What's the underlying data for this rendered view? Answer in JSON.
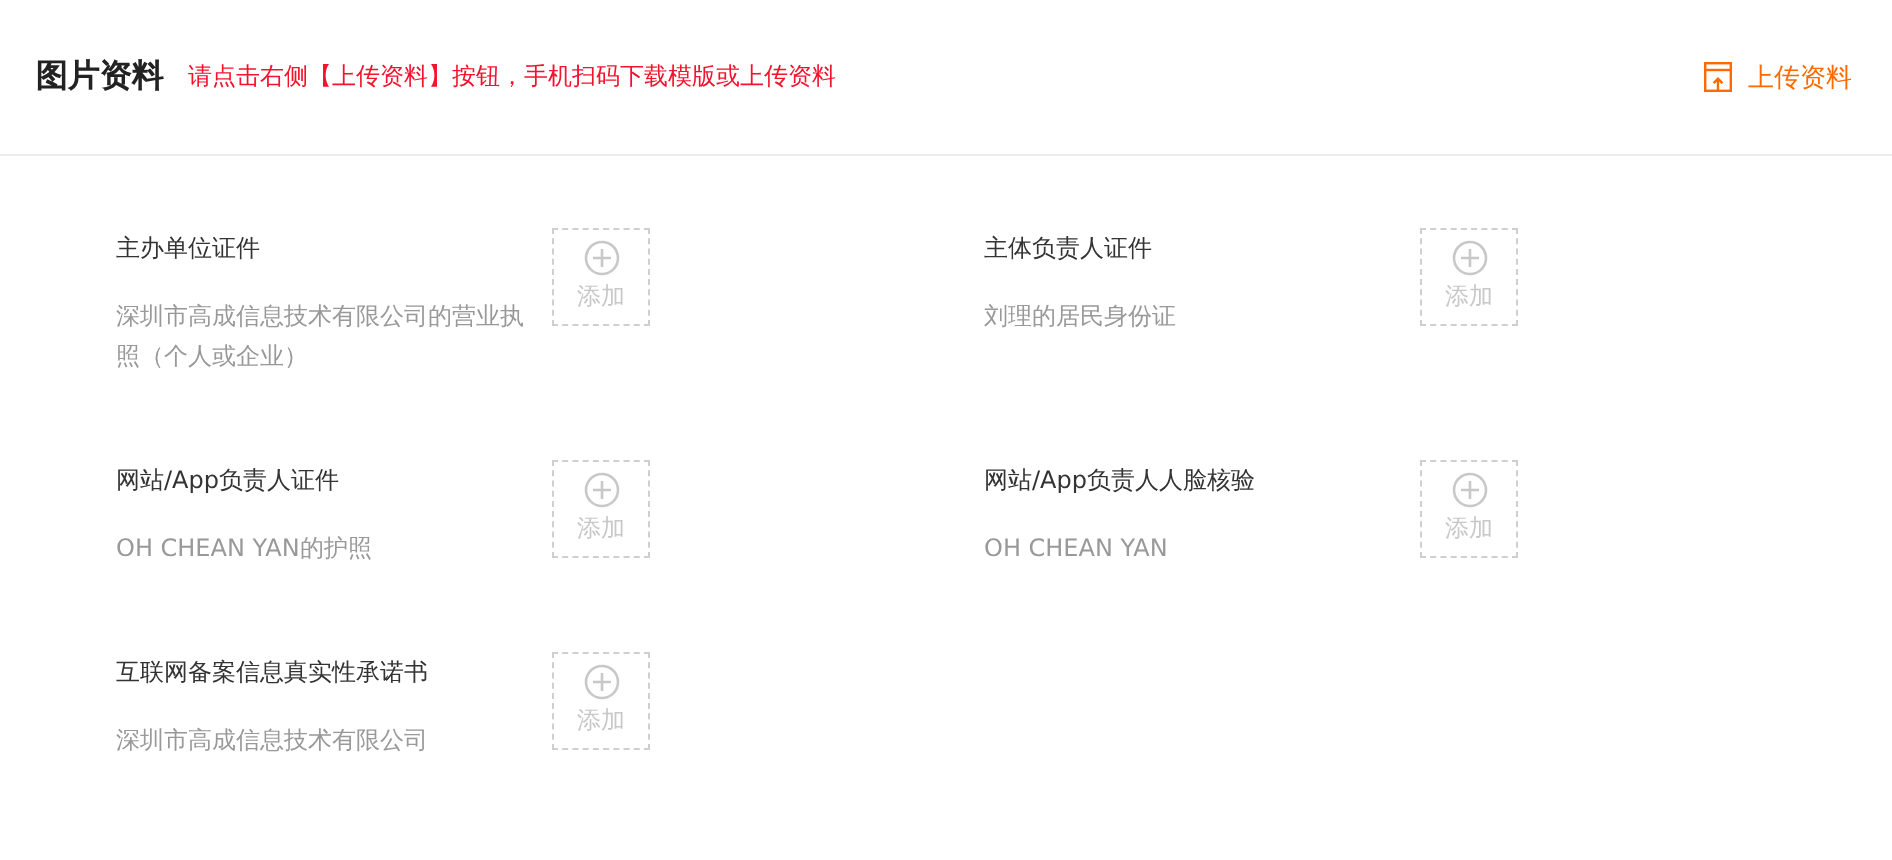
{
  "header": {
    "title": "图片资料",
    "hint": "请点击右侧【上传资料】按钮，手机扫码下载模版或上传资料",
    "upload_button": "上传资料"
  },
  "items": [
    {
      "label": "主办单位证件",
      "detail": "深圳市高成信息技术有限公司的营业执照（个人或企业）",
      "add": "添加"
    },
    {
      "label": "主体负责人证件",
      "detail": "刘理的居民身份证",
      "add": "添加"
    },
    {
      "label": "网站/App负责人证件",
      "detail": "OH CHEAN YAN的护照",
      "add": "添加"
    },
    {
      "label": "网站/App负责人人脸核验",
      "detail": "OH CHEAN YAN",
      "add": "添加"
    },
    {
      "label": "互联网备案信息真实性承诺书",
      "detail": "深圳市高成信息技术有限公司",
      "add": "添加"
    }
  ]
}
